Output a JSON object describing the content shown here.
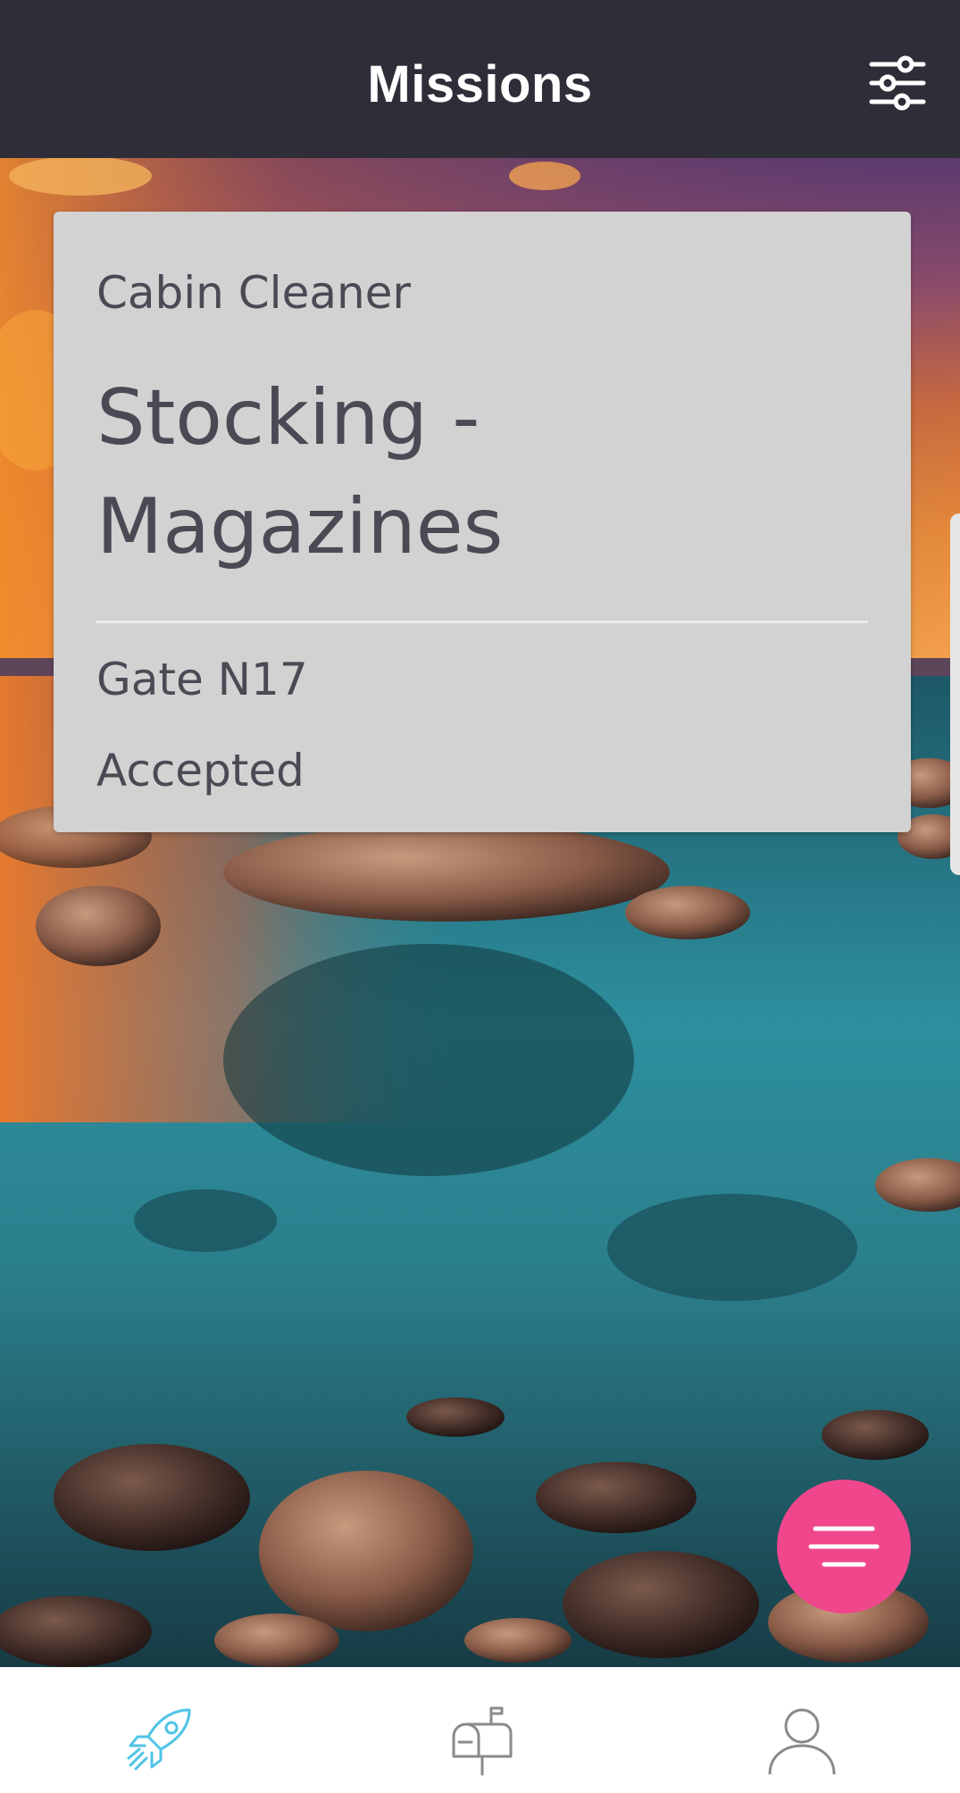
{
  "header": {
    "title": "Missions",
    "filter_icon": "sliders-icon"
  },
  "mission_card": {
    "role": "Cabin Cleaner",
    "title": "Stocking - Magazines",
    "gate": "Gate N17",
    "status": "Accepted"
  },
  "fab": {
    "icon": "menu-lines-icon",
    "color": "#f0468c"
  },
  "bottom_nav": {
    "items": [
      {
        "icon": "rocket-icon",
        "active": true
      },
      {
        "icon": "mailbox-icon",
        "active": false
      },
      {
        "icon": "user-icon",
        "active": false
      }
    ],
    "active_color": "#4fc3e6",
    "inactive_color": "#8a8a8a"
  },
  "colors": {
    "header_bg": "#2f2e38",
    "card_bg": "#d2d2d2",
    "card_text": "#4a4a54"
  }
}
